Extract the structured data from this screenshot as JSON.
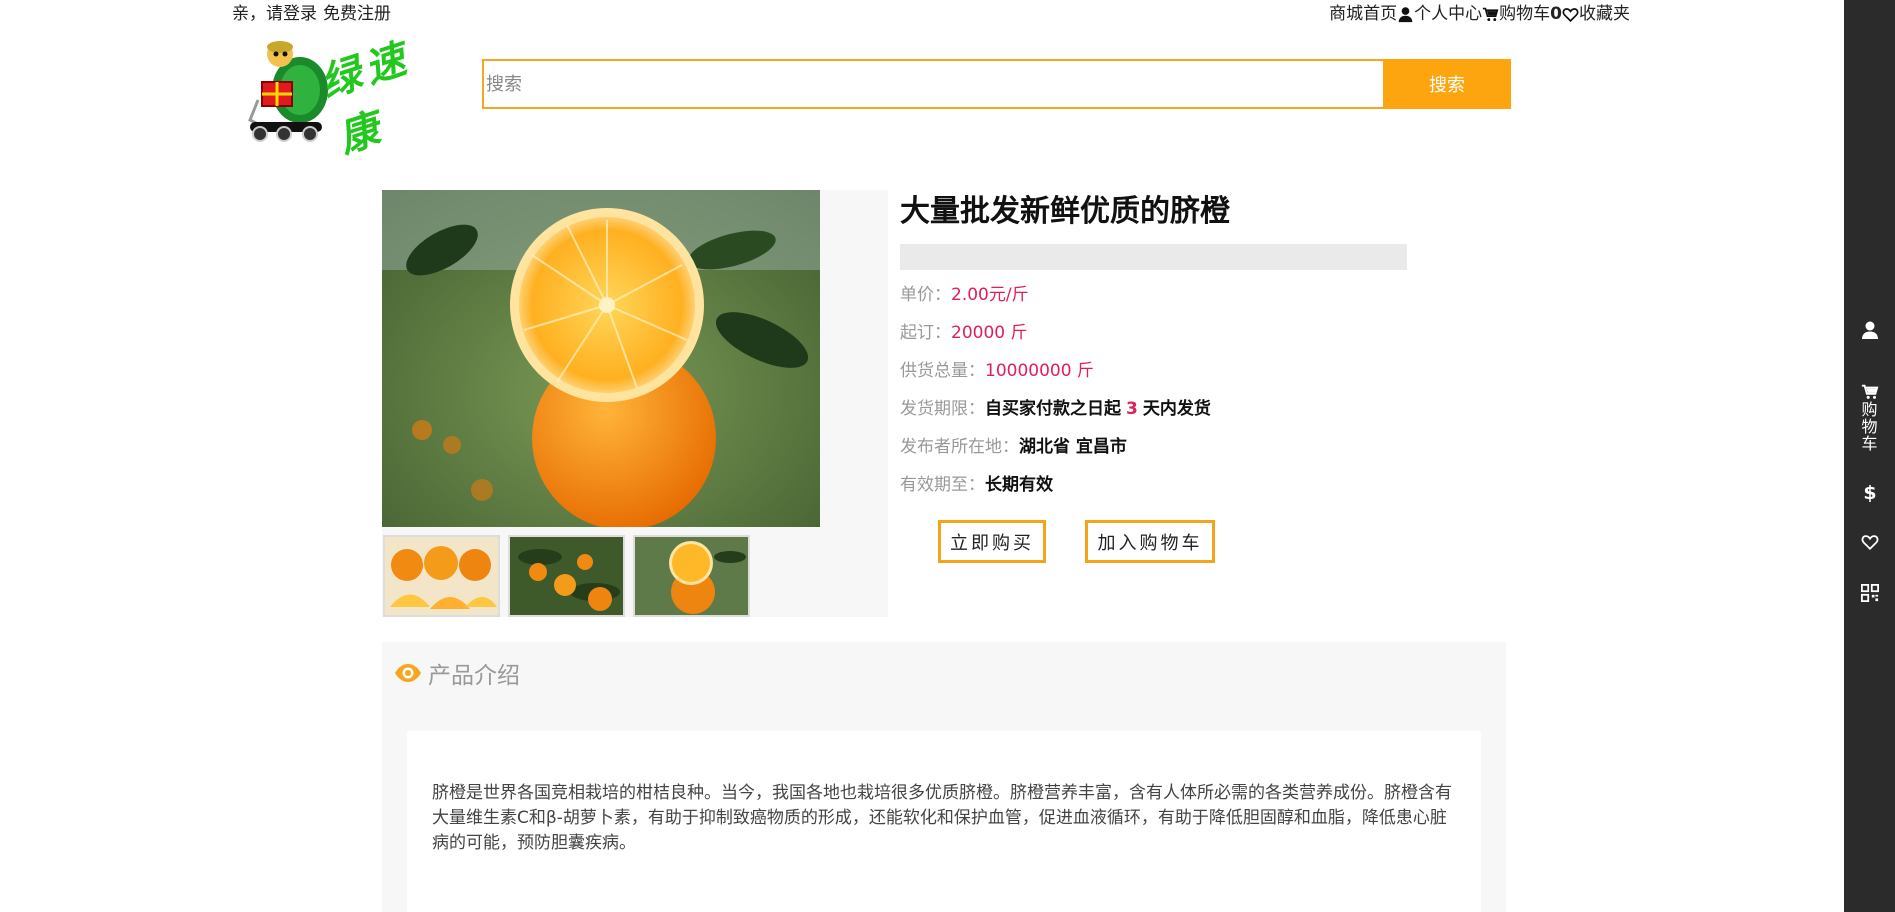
{
  "topbar": {
    "login_text": "亲，请登录",
    "register_text": "免费注册",
    "home_link": "商城首页",
    "profile_link": "个人中心",
    "cart_link": "购物车",
    "cart_count": "0",
    "favorites_link": "收藏夹"
  },
  "header": {
    "logo_text": "绿速康",
    "search_placeholder": "搜索",
    "search_button": "搜索"
  },
  "product": {
    "title": "大量批发新鲜优质的脐橙",
    "unit_price_label": "单价：",
    "unit_price_value": "2.00元/斤",
    "min_order_label": "起订：",
    "min_order_value": "20000 斤",
    "supply_label": "供货总量：",
    "supply_value": "10000000 斤",
    "ship_label": "发货期限：",
    "ship_prefix": "自买家付款之日起",
    "ship_days": "3",
    "ship_suffix": "天内发货",
    "location_label": "发布者所在地：",
    "location_value": "湖北省 宜昌市",
    "valid_label": "有效期至：",
    "valid_value": "长期有效",
    "buy_now_button": "立即购买",
    "add_cart_button": "加入购物车"
  },
  "intro": {
    "heading": "产品介绍",
    "text": "脐橙是世界各国竞相栽培的柑桔良种。当今，我国各地也栽培很多优质脐橙。脐橙营养丰富，含有人体所必需的各类营养成份。脐橙含有大量维生素C和β-胡萝卜素，有助于抑制致癌物质的形成，还能软化和保护血管，促进血液循环，有助于降低胆固醇和血脂，降低患心脏病的可能，预防胆囊疾病。"
  },
  "sidebar": {
    "cart_label": "购物车",
    "icons": [
      "user-icon",
      "cart-icon",
      "dollar-icon",
      "heart-icon",
      "qrcode-icon"
    ]
  },
  "colors": {
    "accent": "#fda50f",
    "price_red": "#e01e5a",
    "sidebar_bg": "#2b2b2b",
    "logo_green": "#22c81e"
  }
}
